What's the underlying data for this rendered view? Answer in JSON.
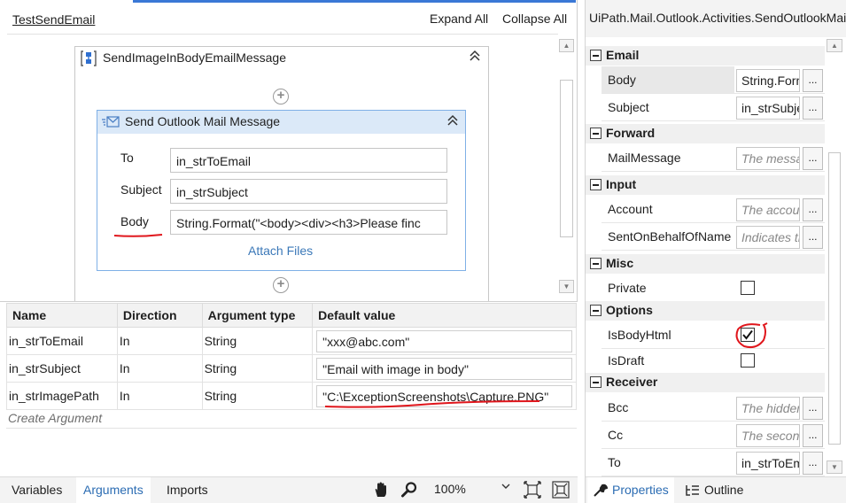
{
  "designer": {
    "breadcrumb": "TestSendEmail",
    "expand_all": "Expand All",
    "collapse_all": "Collapse All",
    "sequence": {
      "title": "SendImageInBodyEmailMessage",
      "collapse_icon": "double-chevron-up-icon"
    },
    "activity": {
      "title": "Send Outlook Mail Message",
      "fields": [
        {
          "label": "To",
          "value": "in_strToEmail"
        },
        {
          "label": "Subject",
          "value": "in_strSubject"
        },
        {
          "label": "Body",
          "value": "String.Format(\"<body><div><h3>Please finc"
        }
      ],
      "attach_files": "Attach Files"
    },
    "annotation_color": "#e0161c"
  },
  "arguments": {
    "headers": [
      "Name",
      "Direction",
      "Argument type",
      "Default value"
    ],
    "rows": [
      {
        "name": "in_strToEmail",
        "direction": "In",
        "type": "String",
        "default": "\"xxx@abc.com\""
      },
      {
        "name": "in_strSubject",
        "direction": "In",
        "type": "String",
        "default": "\"Email with image in body\""
      },
      {
        "name": "in_strImagePath",
        "direction": "In",
        "type": "String",
        "default": "\"C:\\ExceptionScreenshots\\Capture.PNG\""
      }
    ],
    "create_argument": "Create Argument"
  },
  "bottom_bar": {
    "tabs": [
      "Variables",
      "Arguments",
      "Imports"
    ],
    "active_tab": "Arguments",
    "zoom": "100%"
  },
  "properties": {
    "title": "UiPath.Mail.Outlook.Activities.SendOutlookMail",
    "categories": [
      {
        "name": "Email",
        "props": [
          {
            "name": "Body",
            "value": "String.Format(\"<body>",
            "kind": "text",
            "selected": true
          },
          {
            "name": "Subject",
            "value": "in_strSubject",
            "kind": "text"
          }
        ]
      },
      {
        "name": "Forward",
        "props": [
          {
            "name": "MailMessage",
            "value": "The message to be forwarded",
            "kind": "placeholder"
          }
        ]
      },
      {
        "name": "Input",
        "props": [
          {
            "name": "Account",
            "value": "The account used to send",
            "kind": "placeholder"
          },
          {
            "name": "SentOnBehalfOfName",
            "value": "Indicates the name",
            "kind": "placeholder"
          }
        ]
      },
      {
        "name": "Misc",
        "props": [
          {
            "name": "Private",
            "kind": "checkbox",
            "checked": false
          }
        ]
      },
      {
        "name": "Options",
        "props": [
          {
            "name": "IsBodyHtml",
            "kind": "checkbox",
            "checked": true
          },
          {
            "name": "IsDraft",
            "kind": "checkbox",
            "checked": false
          }
        ]
      },
      {
        "name": "Receiver",
        "props": [
          {
            "name": "Bcc",
            "value": "The hidden recipients",
            "kind": "placeholder"
          },
          {
            "name": "Cc",
            "value": "The secondary recipients",
            "kind": "placeholder"
          },
          {
            "name": "To",
            "value": "in_strToEmail",
            "kind": "text"
          }
        ]
      }
    ],
    "tabs": {
      "properties": "Properties",
      "outline": "Outline"
    }
  }
}
